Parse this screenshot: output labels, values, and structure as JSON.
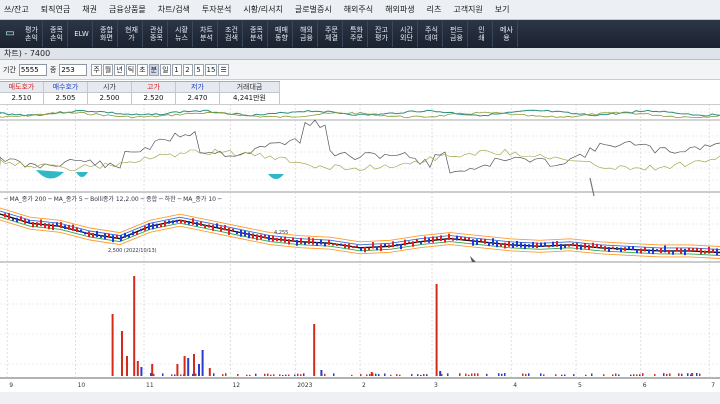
{
  "menubar": [
    "쓰/잔고",
    "퇴직연금",
    "채권",
    "금융상품몰",
    "차트/검색",
    "투자분석",
    "시황/리서치",
    "글로벌증시",
    "해외주식",
    "해외파생",
    "리츠",
    "고객지원",
    "보기"
  ],
  "toolbar": [
    {
      "icon": "monitor-icon",
      "label": ""
    },
    {
      "icon": "profit-icon",
      "label": "평가\n손익"
    },
    {
      "icon": "stock-profit-icon",
      "label": "종목\n손익"
    },
    {
      "icon": "elw-icon",
      "label": "ELW"
    },
    {
      "icon": "combined-screen-icon",
      "label": "종합\n화면"
    },
    {
      "icon": "current-price-icon",
      "label": "현재\n가"
    },
    {
      "icon": "watchlist-icon",
      "label": "관심\n종목"
    },
    {
      "icon": "market-news-icon",
      "label": "시황\n뉴스"
    },
    {
      "icon": "chart-analysis-icon",
      "label": "차트\n분석"
    },
    {
      "icon": "condition-search-icon",
      "label": "조건\n검색"
    },
    {
      "icon": "stock-analysis-icon",
      "label": "종목\n분석"
    },
    {
      "icon": "trading-trend-icon",
      "label": "매매\n동향"
    },
    {
      "icon": "overseas-finance-icon",
      "label": "해외\n금융"
    },
    {
      "icon": "order-execution-icon",
      "label": "주문\n체결"
    },
    {
      "icon": "special-order-icon",
      "label": "특화\n주문"
    },
    {
      "icon": "balance-eval-icon",
      "label": "잔고\n평가"
    },
    {
      "icon": "overtime-order-icon",
      "label": "시간\n외단"
    },
    {
      "icon": "stock-lending-icon",
      "label": "주식\n대여"
    },
    {
      "icon": "fund-finance-icon",
      "label": "펀드\n금융"
    },
    {
      "icon": "certificate-icon",
      "label": "인\n쇄"
    },
    {
      "icon": "messenger-icon",
      "label": "메사\n용"
    }
  ],
  "window": {
    "title": "차트) - 7400"
  },
  "controls": {
    "period_label": "기간",
    "period_value": "5555",
    "count_label": "종",
    "count_value": "253",
    "period_tabs": [
      "주",
      "월",
      "년",
      "틱",
      "초",
      "분",
      "일",
      "1",
      "2",
      "5",
      "15",
      "☰"
    ],
    "active_tab": "분"
  },
  "quote": {
    "headers": [
      "매도호가",
      "매수호가",
      "시가",
      "고가",
      "저가",
      "거래대금"
    ],
    "values": [
      "2.510",
      "2.505",
      "2.500",
      "2.520",
      "2.470",
      "4,241만원"
    ]
  },
  "chart_legend": "─ MA_종가 200 ─ MA_종가 5 ─ Bolli종가 12,2.00 ─ 종합 ─ 하한 ─ MA_종가 10 ─",
  "chart_notes": {
    "price_note": "2,500 (2022/10/13)",
    "label_a": "4,255"
  },
  "xaxis_labels": [
    "9",
    "10",
    "11",
    "12",
    "2023",
    "2",
    "3",
    "4",
    "5",
    "6",
    "7"
  ],
  "chart_data": {
    "type": "bar",
    "x": [
      {
        "label": "9",
        "pos": 0.01
      },
      {
        "label": "10",
        "pos": 0.105
      },
      {
        "label": "11",
        "pos": 0.2
      },
      {
        "label": "12",
        "pos": 0.32
      },
      {
        "label": "2023",
        "pos": 0.41
      },
      {
        "label": "2",
        "pos": 0.5
      },
      {
        "label": "3",
        "pos": 0.6
      },
      {
        "label": "4",
        "pos": 0.71
      },
      {
        "label": "5",
        "pos": 0.8
      },
      {
        "label": "6",
        "pos": 0.89
      },
      {
        "label": "7",
        "pos": 0.985
      }
    ],
    "volume_bars": [
      {
        "t": 0.155,
        "v": 62,
        "c": "red"
      },
      {
        "t": 0.168,
        "v": 45,
        "c": "red"
      },
      {
        "t": 0.175,
        "v": 20,
        "c": "red"
      },
      {
        "t": 0.185,
        "v": 100,
        "c": "red"
      },
      {
        "t": 0.19,
        "v": 15,
        "c": "red"
      },
      {
        "t": 0.195,
        "v": 9,
        "c": "blue"
      },
      {
        "t": 0.21,
        "v": 12,
        "c": "red"
      },
      {
        "t": 0.245,
        "v": 12,
        "c": "red"
      },
      {
        "t": 0.255,
        "v": 20,
        "c": "red"
      },
      {
        "t": 0.26,
        "v": 18,
        "c": "blue"
      },
      {
        "t": 0.268,
        "v": 22,
        "c": "red"
      },
      {
        "t": 0.275,
        "v": 12,
        "c": "blue"
      },
      {
        "t": 0.28,
        "v": 26,
        "c": "blue"
      },
      {
        "t": 0.29,
        "v": 8,
        "c": "red"
      },
      {
        "t": 0.435,
        "v": 52,
        "c": "red"
      },
      {
        "t": 0.445,
        "v": 6,
        "c": "blue"
      },
      {
        "t": 0.515,
        "v": 4,
        "c": "red"
      },
      {
        "t": 0.605,
        "v": 92,
        "c": "red"
      },
      {
        "t": 0.61,
        "v": 5,
        "c": "blue"
      },
      {
        "t": 0.96,
        "v": 3,
        "c": "red"
      }
    ],
    "main_series": [
      2.68,
      2.62,
      2.6,
      2.55,
      2.52,
      2.6,
      2.64,
      2.6,
      2.56,
      2.52,
      2.5,
      2.49,
      2.46,
      2.47,
      2.5,
      2.52,
      2.5,
      2.48,
      2.47,
      2.48,
      2.46,
      2.45,
      2.44,
      2.44,
      2.43
    ]
  }
}
